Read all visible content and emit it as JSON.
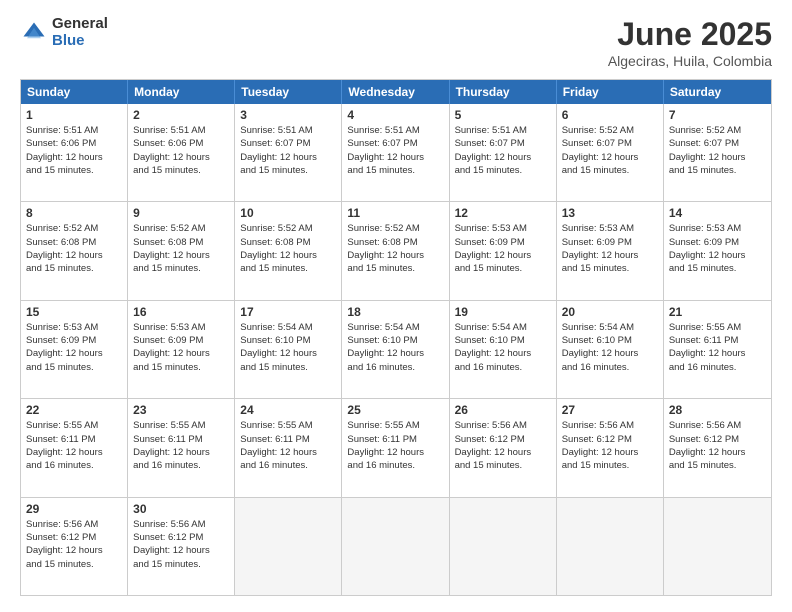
{
  "logo": {
    "general": "General",
    "blue": "Blue"
  },
  "title": {
    "month": "June 2025",
    "location": "Algeciras, Huila, Colombia"
  },
  "days": [
    "Sunday",
    "Monday",
    "Tuesday",
    "Wednesday",
    "Thursday",
    "Friday",
    "Saturday"
  ],
  "weeks": [
    [
      {
        "day": "1",
        "lines": [
          "Sunrise: 5:51 AM",
          "Sunset: 6:06 PM",
          "Daylight: 12 hours",
          "and 15 minutes."
        ],
        "empty": false
      },
      {
        "day": "2",
        "lines": [
          "Sunrise: 5:51 AM",
          "Sunset: 6:06 PM",
          "Daylight: 12 hours",
          "and 15 minutes."
        ],
        "empty": false
      },
      {
        "day": "3",
        "lines": [
          "Sunrise: 5:51 AM",
          "Sunset: 6:07 PM",
          "Daylight: 12 hours",
          "and 15 minutes."
        ],
        "empty": false
      },
      {
        "day": "4",
        "lines": [
          "Sunrise: 5:51 AM",
          "Sunset: 6:07 PM",
          "Daylight: 12 hours",
          "and 15 minutes."
        ],
        "empty": false
      },
      {
        "day": "5",
        "lines": [
          "Sunrise: 5:51 AM",
          "Sunset: 6:07 PM",
          "Daylight: 12 hours",
          "and 15 minutes."
        ],
        "empty": false
      },
      {
        "day": "6",
        "lines": [
          "Sunrise: 5:52 AM",
          "Sunset: 6:07 PM",
          "Daylight: 12 hours",
          "and 15 minutes."
        ],
        "empty": false
      },
      {
        "day": "7",
        "lines": [
          "Sunrise: 5:52 AM",
          "Sunset: 6:07 PM",
          "Daylight: 12 hours",
          "and 15 minutes."
        ],
        "empty": false
      }
    ],
    [
      {
        "day": "8",
        "lines": [
          "Sunrise: 5:52 AM",
          "Sunset: 6:08 PM",
          "Daylight: 12 hours",
          "and 15 minutes."
        ],
        "empty": false
      },
      {
        "day": "9",
        "lines": [
          "Sunrise: 5:52 AM",
          "Sunset: 6:08 PM",
          "Daylight: 12 hours",
          "and 15 minutes."
        ],
        "empty": false
      },
      {
        "day": "10",
        "lines": [
          "Sunrise: 5:52 AM",
          "Sunset: 6:08 PM",
          "Daylight: 12 hours",
          "and 15 minutes."
        ],
        "empty": false
      },
      {
        "day": "11",
        "lines": [
          "Sunrise: 5:52 AM",
          "Sunset: 6:08 PM",
          "Daylight: 12 hours",
          "and 15 minutes."
        ],
        "empty": false
      },
      {
        "day": "12",
        "lines": [
          "Sunrise: 5:53 AM",
          "Sunset: 6:09 PM",
          "Daylight: 12 hours",
          "and 15 minutes."
        ],
        "empty": false
      },
      {
        "day": "13",
        "lines": [
          "Sunrise: 5:53 AM",
          "Sunset: 6:09 PM",
          "Daylight: 12 hours",
          "and 15 minutes."
        ],
        "empty": false
      },
      {
        "day": "14",
        "lines": [
          "Sunrise: 5:53 AM",
          "Sunset: 6:09 PM",
          "Daylight: 12 hours",
          "and 15 minutes."
        ],
        "empty": false
      }
    ],
    [
      {
        "day": "15",
        "lines": [
          "Sunrise: 5:53 AM",
          "Sunset: 6:09 PM",
          "Daylight: 12 hours",
          "and 15 minutes."
        ],
        "empty": false
      },
      {
        "day": "16",
        "lines": [
          "Sunrise: 5:53 AM",
          "Sunset: 6:09 PM",
          "Daylight: 12 hours",
          "and 15 minutes."
        ],
        "empty": false
      },
      {
        "day": "17",
        "lines": [
          "Sunrise: 5:54 AM",
          "Sunset: 6:10 PM",
          "Daylight: 12 hours",
          "and 15 minutes."
        ],
        "empty": false
      },
      {
        "day": "18",
        "lines": [
          "Sunrise: 5:54 AM",
          "Sunset: 6:10 PM",
          "Daylight: 12 hours",
          "and 16 minutes."
        ],
        "empty": false
      },
      {
        "day": "19",
        "lines": [
          "Sunrise: 5:54 AM",
          "Sunset: 6:10 PM",
          "Daylight: 12 hours",
          "and 16 minutes."
        ],
        "empty": false
      },
      {
        "day": "20",
        "lines": [
          "Sunrise: 5:54 AM",
          "Sunset: 6:10 PM",
          "Daylight: 12 hours",
          "and 16 minutes."
        ],
        "empty": false
      },
      {
        "day": "21",
        "lines": [
          "Sunrise: 5:55 AM",
          "Sunset: 6:11 PM",
          "Daylight: 12 hours",
          "and 16 minutes."
        ],
        "empty": false
      }
    ],
    [
      {
        "day": "22",
        "lines": [
          "Sunrise: 5:55 AM",
          "Sunset: 6:11 PM",
          "Daylight: 12 hours",
          "and 16 minutes."
        ],
        "empty": false
      },
      {
        "day": "23",
        "lines": [
          "Sunrise: 5:55 AM",
          "Sunset: 6:11 PM",
          "Daylight: 12 hours",
          "and 16 minutes."
        ],
        "empty": false
      },
      {
        "day": "24",
        "lines": [
          "Sunrise: 5:55 AM",
          "Sunset: 6:11 PM",
          "Daylight: 12 hours",
          "and 16 minutes."
        ],
        "empty": false
      },
      {
        "day": "25",
        "lines": [
          "Sunrise: 5:55 AM",
          "Sunset: 6:11 PM",
          "Daylight: 12 hours",
          "and 16 minutes."
        ],
        "empty": false
      },
      {
        "day": "26",
        "lines": [
          "Sunrise: 5:56 AM",
          "Sunset: 6:12 PM",
          "Daylight: 12 hours",
          "and 15 minutes."
        ],
        "empty": false
      },
      {
        "day": "27",
        "lines": [
          "Sunrise: 5:56 AM",
          "Sunset: 6:12 PM",
          "Daylight: 12 hours",
          "and 15 minutes."
        ],
        "empty": false
      },
      {
        "day": "28",
        "lines": [
          "Sunrise: 5:56 AM",
          "Sunset: 6:12 PM",
          "Daylight: 12 hours",
          "and 15 minutes."
        ],
        "empty": false
      }
    ],
    [
      {
        "day": "29",
        "lines": [
          "Sunrise: 5:56 AM",
          "Sunset: 6:12 PM",
          "Daylight: 12 hours",
          "and 15 minutes."
        ],
        "empty": false
      },
      {
        "day": "30",
        "lines": [
          "Sunrise: 5:56 AM",
          "Sunset: 6:12 PM",
          "Daylight: 12 hours",
          "and 15 minutes."
        ],
        "empty": false
      },
      {
        "day": "",
        "lines": [],
        "empty": true
      },
      {
        "day": "",
        "lines": [],
        "empty": true
      },
      {
        "day": "",
        "lines": [],
        "empty": true
      },
      {
        "day": "",
        "lines": [],
        "empty": true
      },
      {
        "day": "",
        "lines": [],
        "empty": true
      }
    ]
  ]
}
